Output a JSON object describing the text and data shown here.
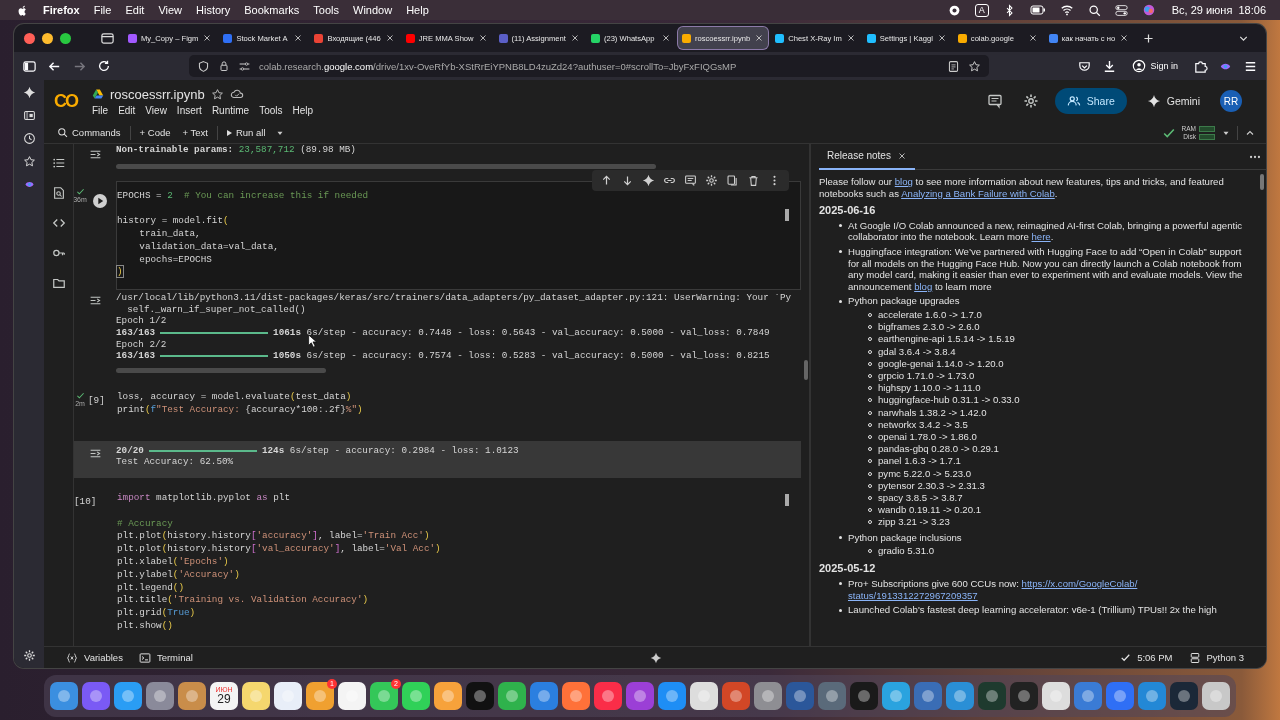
{
  "menu_bar": {
    "app": "Firefox",
    "items": [
      "File",
      "Edit",
      "View",
      "History",
      "Bookmarks",
      "Tools",
      "Window",
      "Help"
    ],
    "keyboard": "A",
    "clock": "Вс, 29 июня  18:06"
  },
  "browser": {
    "tabs": [
      {
        "title": "My_Copy – Figm",
        "selected": false,
        "color": "#a259ff"
      },
      {
        "title": "Stock Market A",
        "selected": false,
        "color": "#2f6ff5"
      },
      {
        "title": "Входящие (446",
        "selected": false,
        "color": "#ea4335"
      },
      {
        "title": "JRE MMA Show",
        "selected": false,
        "color": "#ff0000"
      },
      {
        "title": "(11) Assignment",
        "selected": false,
        "color": "#5b5fc7"
      },
      {
        "title": "(23) WhatsApp",
        "selected": false,
        "color": "#25d366"
      },
      {
        "title": "roscoessrr.ipynb",
        "selected": true,
        "color": "#f9ab00"
      },
      {
        "title": "Chest X-Ray Im",
        "selected": false,
        "color": "#20beff"
      },
      {
        "title": "Settings | Kaggl",
        "selected": false,
        "color": "#20beff"
      },
      {
        "title": "colab.google",
        "selected": false,
        "color": "#f9ab00"
      },
      {
        "title": "как начать с но",
        "selected": false,
        "color": "#4285f4"
      }
    ],
    "url": {
      "before": "colab.research.",
      "domain": "google.com",
      "after": "/drive/1xv-OveRfYb-XStRrEiYPNB8LD4zuZd24?authuser=0#scrollTo=JbyFxFIQGsMP"
    },
    "sign_in": "Sign in"
  },
  "colab": {
    "logo": "CO",
    "title": "roscoessrr.ipynb",
    "menus": [
      "File",
      "Edit",
      "View",
      "Insert",
      "Runtime",
      "Tools",
      "Help"
    ],
    "share": "Share",
    "gemini": "Gemini",
    "avatar": "RR",
    "toolbar": [
      "Commands",
      "+ Code",
      "+ Text",
      "Run all"
    ],
    "ram": "RAM",
    "disk": "Disk"
  },
  "top_output": [
    {
      "t": "Non-trainable params: ",
      "kind": "bold"
    },
    {
      "t": "23,587,712",
      "kind": "num"
    },
    {
      "t": " (89.98 MB)",
      "kind": "plain"
    }
  ],
  "cells": [
    {
      "kind": "code",
      "ran": true,
      "duration": "36m",
      "run_button": true,
      "toolbar": true,
      "lines": [
        [
          {
            "t": "EPOCHS = ",
            "kind": "plain"
          },
          {
            "t": "2",
            "kind": "num"
          },
          {
            "t": "  # You can increase this if needed",
            "kind": "comment"
          }
        ],
        {
          "blank_before": true,
          "tokens": [
            {
              "t": "history = model.fit",
              "kind": "plain"
            },
            {
              "t": "(",
              "kind": "bracket"
            }
          ]
        },
        [
          {
            "t": "    train_data,",
            "kind": "plain"
          }
        ],
        [
          {
            "t": "    validation_data=val_data,",
            "kind": "plain"
          }
        ],
        [
          {
            "t": "    epochs=EPOCHS",
            "kind": "plain"
          }
        ],
        [
          {
            "t": ")",
            "kind": "cursor"
          }
        ]
      ],
      "output": {
        "shaded": false,
        "lines": [
          {
            "kind": "text",
            "text": "/usr/local/lib/python3.11/dist-packages/keras/src/trainers/data_adapters/py_dataset_adapter.py:121: UserWarning: Your `Py"
          },
          {
            "kind": "text",
            "text": "  self._warn_if_super_not_called()"
          },
          {
            "kind": "text",
            "text": "Epoch 1/2"
          },
          {
            "kind": "progress",
            "count": "163/163",
            "level": 1,
            "time": "1061s",
            "rest": " 6s/step - accuracy: 0.7448 - loss: 0.5643 - val_accuracy: 0.5000 - val_loss: 0.7849"
          },
          {
            "kind": "text",
            "text": "Epoch 2/2"
          },
          {
            "kind": "progress",
            "count": "163/163",
            "level": 1,
            "time": "1050s",
            "rest": " 6s/step - accuracy: 0.7574 - loss: 0.5283 - val_accuracy: 0.5000 - val_loss: 0.8215"
          }
        ]
      }
    },
    {
      "kind": "code",
      "label": "[9]",
      "ran": true,
      "duration": "2m",
      "run_button": false,
      "toolbar": false,
      "lines": [
        [
          {
            "t": "loss, accuracy = model.evaluate",
            "kind": "plain"
          },
          {
            "t": "(",
            "kind": "bracket"
          },
          {
            "t": "test_data",
            "kind": "plain"
          },
          {
            "t": ")",
            "kind": "bracket"
          }
        ],
        [
          {
            "t": "print",
            "kind": "plain"
          },
          {
            "t": "(",
            "kind": "bracket"
          },
          {
            "t": "f",
            "kind": "keyword2"
          },
          {
            "t": "\"Test Accuracy: ",
            "kind": "string"
          },
          {
            "t": "{accuracy*100:.2f}",
            "kind": "plain"
          },
          {
            "t": "%\"",
            "kind": "string"
          },
          {
            "t": ")",
            "kind": "bracket"
          }
        ]
      ],
      "output": {
        "shaded": true,
        "lines": [
          {
            "kind": "progress",
            "count": "20/20",
            "level": 1,
            "time": "124s",
            "rest": " 6s/step - accuracy: 0.2984 - loss: 1.0123"
          },
          {
            "kind": "text",
            "text": "Test Accuracy: 62.50%"
          }
        ]
      }
    },
    {
      "kind": "code",
      "label": "[10]",
      "ran": false,
      "run_button": false,
      "toolbar": false,
      "lines": [
        [
          {
            "t": "import",
            "kind": "keyword"
          },
          {
            "t": " matplotlib.pyplot ",
            "kind": "plain"
          },
          {
            "t": "as",
            "kind": "keyword"
          },
          {
            "t": " plt",
            "kind": "plain"
          }
        ],
        {
          "blank_before": true,
          "tokens": [
            {
              "t": "# Accuracy",
              "kind": "comment"
            }
          ]
        },
        [
          {
            "t": "plt.plot",
            "kind": "plain"
          },
          {
            "t": "(",
            "kind": "bracket"
          },
          {
            "t": "history.history",
            "kind": "plain"
          },
          {
            "t": "[",
            "kind": "bracket2"
          },
          {
            "t": "'accuracy'",
            "kind": "string"
          },
          {
            "t": "]",
            "kind": "bracket2"
          },
          {
            "t": ", label=",
            "kind": "plain"
          },
          {
            "t": "'Train Acc'",
            "kind": "string"
          },
          {
            "t": ")",
            "kind": "bracket"
          }
        ],
        [
          {
            "t": "plt.plot",
            "kind": "plain"
          },
          {
            "t": "(",
            "kind": "bracket"
          },
          {
            "t": "history.history",
            "kind": "plain"
          },
          {
            "t": "[",
            "kind": "bracket2"
          },
          {
            "t": "'val_accuracy'",
            "kind": "string"
          },
          {
            "t": "]",
            "kind": "bracket2"
          },
          {
            "t": ", label=",
            "kind": "plain"
          },
          {
            "t": "'Val Acc'",
            "kind": "string"
          },
          {
            "t": ")",
            "kind": "bracket"
          }
        ],
        [
          {
            "t": "plt.xlabel",
            "kind": "plain"
          },
          {
            "t": "(",
            "kind": "bracket"
          },
          {
            "t": "'Epochs'",
            "kind": "string"
          },
          {
            "t": ")",
            "kind": "bracket"
          }
        ],
        [
          {
            "t": "plt.ylabel",
            "kind": "plain"
          },
          {
            "t": "(",
            "kind": "bracket"
          },
          {
            "t": "'Accuracy'",
            "kind": "string"
          },
          {
            "t": ")",
            "kind": "bracket"
          }
        ],
        [
          {
            "t": "plt.legend",
            "kind": "plain"
          },
          {
            "t": "()",
            "kind": "bracket"
          }
        ],
        [
          {
            "t": "plt.title",
            "kind": "plain"
          },
          {
            "t": "(",
            "kind": "bracket"
          },
          {
            "t": "'Training vs. Validation Accuracy'",
            "kind": "string"
          },
          {
            "t": ")",
            "kind": "bracket"
          }
        ],
        [
          {
            "t": "plt.grid",
            "kind": "plain"
          },
          {
            "t": "(",
            "kind": "bracket"
          },
          {
            "t": "True",
            "kind": "keyword2"
          },
          {
            "t": ")",
            "kind": "bracket"
          }
        ],
        [
          {
            "t": "plt.show",
            "kind": "plain"
          },
          {
            "t": "()",
            "kind": "bracket"
          }
        ]
      ]
    }
  ],
  "release_notes": {
    "tab": "Release notes",
    "intro": [
      {
        "t": "Please follow our "
      },
      {
        "t": "blog",
        "link": true
      },
      {
        "t": " to see more information about new features, tips and tricks, and featured notebooks such as "
      },
      {
        "t": "Analyzing a Bank Failure with Colab",
        "link": true
      },
      {
        "t": "."
      }
    ],
    "sections": [
      {
        "date": "2025-06-16",
        "items": [
          {
            "text": [
              {
                "t": "At Google I/O Colab announced a new, reimagined AI-first Colab, bringing a powerful agentic collaborator into the notebook. Learn more "
              },
              {
                "t": "here",
                "link": true
              },
              {
                "t": "."
              }
            ]
          },
          {
            "text": [
              {
                "t": "Huggingface integration: We’ve partnered with Hugging Face to add “Open in Colab” support for all models on the Hugging Face Hub. Now you can directly launch a Colab notebook from any model card, making it easier than ever to experiment with and evaluate models. View the announcement "
              },
              {
                "t": "blog",
                "link": true
              },
              {
                "t": " to learn more"
              }
            ]
          },
          {
            "text": [
              {
                "t": "Python package upgrades"
              }
            ],
            "children": [
              "accelerate 1.6.0 -> 1.7.0",
              "bigframes 2.3.0 -> 2.6.0",
              "earthengine-api 1.5.14 -> 1.5.19",
              "gdal 3.6.4 -> 3.8.4",
              "google-genai 1.14.0 -> 1.20.0",
              "grpcio 1.71.0 -> 1.73.0",
              "highspy 1.10.0 -> 1.11.0",
              "huggingface-hub 0.31.1 -> 0.33.0",
              "narwhals 1.38.2 -> 1.42.0",
              "networkx 3.4.2 -> 3.5",
              "openai 1.78.0 -> 1.86.0",
              "pandas-gbq 0.28.0 -> 0.29.1",
              "panel 1.6.3 -> 1.7.1",
              "pymc 5.22.0 -> 5.23.0",
              "pytensor 2.30.3 -> 2.31.3",
              "spacy 3.8.5 -> 3.8.7",
              "wandb 0.19.11 -> 0.20.1",
              "zipp 3.21 -> 3.23"
            ]
          },
          {
            "text": [
              {
                "t": "Python package inclusions"
              }
            ],
            "children": [
              "gradio 5.31.0"
            ]
          }
        ]
      },
      {
        "date": "2025-05-12",
        "items": [
          {
            "text": [
              {
                "t": "Pro+ Subscriptions give 600 CCUs now: "
              },
              {
                "t": "https://x.com/GoogleColab/",
                "link": true
              },
              {
                "t": "status/1913312272967209357",
                "link": true,
                "line_break": true
              }
            ]
          },
          {
            "text": [
              {
                "t": "Launched Colab's fastest deep learning accelerator: v6e-1 (Trillium) TPUs!! 2x the high"
              }
            ]
          }
        ]
      }
    ]
  },
  "status_bar": {
    "variables": "Variables",
    "terminal": "Terminal",
    "time": "5:06 PM",
    "runtime": "Python 3"
  },
  "dock": [
    {
      "color": "#3b8fe0"
    },
    {
      "color": "#7a5af5"
    },
    {
      "color": "#2a9df4"
    },
    {
      "color": "#8a8a9a"
    },
    {
      "color": "#c98d4a"
    },
    {
      "color": "#f4f4f4",
      "kind": "calendar",
      "month": "ИЮН",
      "day": "29"
    },
    {
      "color": "#f5d76e"
    },
    {
      "color": "#e8eef8"
    },
    {
      "color": "#f0a030",
      "badge": "1"
    },
    {
      "color": "#f4f4f4"
    },
    {
      "color": "#34c759",
      "badge": "2"
    },
    {
      "color": "#30d158"
    },
    {
      "color": "#f7a23b"
    },
    {
      "color": "#111111"
    },
    {
      "color": "#2fb24c"
    },
    {
      "color": "#2b7fe0"
    },
    {
      "color": "#ff7139"
    },
    {
      "color": "#fa2d48"
    },
    {
      "color": "#9b3fd6"
    },
    {
      "color": "#1e8ef5"
    },
    {
      "color": "#dddddd"
    },
    {
      "color": "#d24726"
    },
    {
      "color": "#8e8e93"
    },
    {
      "color": "#2b579a"
    },
    {
      "color": "#5a6a7a"
    },
    {
      "color": "#1a1a1a"
    },
    {
      "color": "#2aa3df"
    },
    {
      "color": "#3a6db5"
    },
    {
      "color": "#2a8fd6"
    },
    {
      "color": "#1e3a2e"
    },
    {
      "color": "#222222"
    },
    {
      "color": "#dddddd"
    },
    {
      "color": "#3a7bd5"
    },
    {
      "color": "#2f6ff5"
    },
    {
      "color": "#2388d6"
    },
    {
      "color": "#1b2838"
    },
    {
      "color": "#c8c8c8"
    }
  ]
}
